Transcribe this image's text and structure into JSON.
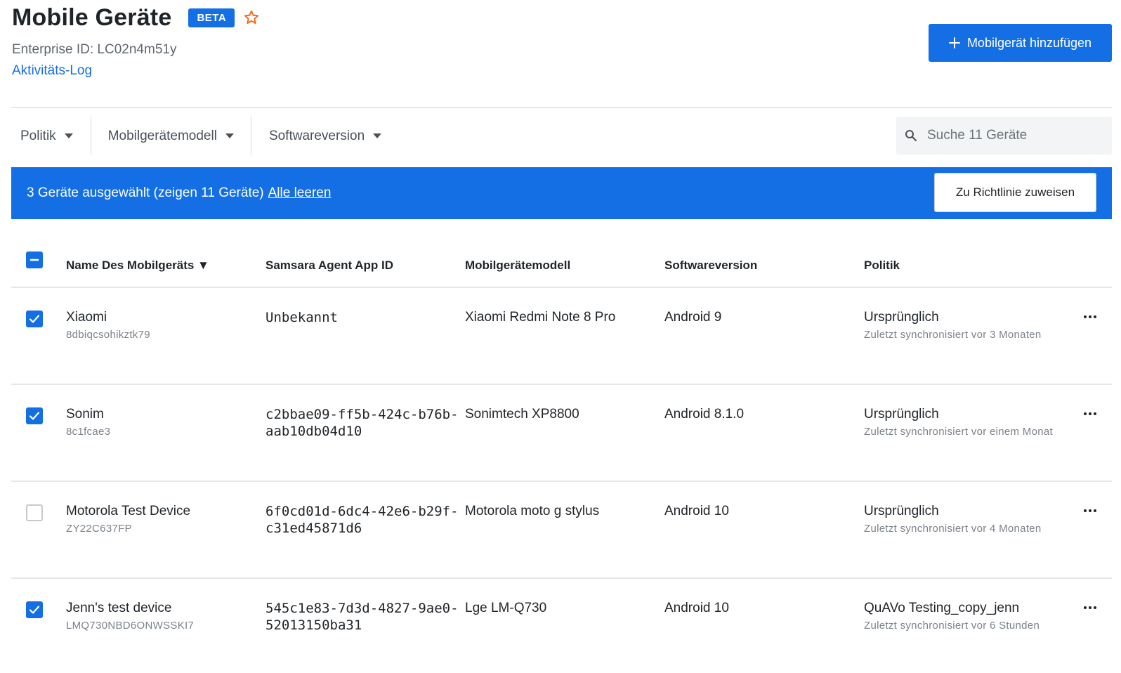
{
  "header": {
    "title": "Mobile Geräte",
    "badge": "BETA",
    "enterprise_id": "Enterprise ID: LC02n4m51y",
    "activity_link": "Aktivitäts-Log",
    "add_button": "Mobilgerät hinzufügen"
  },
  "filters": {
    "policy": "Politik",
    "model": "Mobilgerätemodell",
    "software": "Softwareversion"
  },
  "search": {
    "placeholder": "Suche 11 Geräte"
  },
  "selection": {
    "text": "3 Geräte ausgewählt (zeigen 11 Geräte)",
    "clear": "Alle leeren",
    "assign_button": "Zu Richtlinie zuweisen"
  },
  "table": {
    "headers": {
      "name": "Name Des Mobilgeräts ▼",
      "app_id": "Samsara Agent App ID",
      "model": "Mobilgerätemodell",
      "software": "Softwareversion",
      "policy": "Politik"
    },
    "rows": [
      {
        "checked": true,
        "name": "Xiaomi",
        "serial": "8dbiqcsohikztk79",
        "app_id": "Unbekannt",
        "model": "Xiaomi Redmi Note 8 Pro",
        "software": "Android 9",
        "policy": "Ursprünglich",
        "sync": "Zuletzt synchronisiert vor 3 Monaten"
      },
      {
        "checked": true,
        "name": "Sonim",
        "serial": "8c1fcae3",
        "app_id": "c2bbae09-ff5b-424c-b76b-aab10db04d10",
        "model": "Sonimtech XP8800",
        "software": "Android 8.1.0",
        "policy": "Ursprünglich",
        "sync": "Zuletzt synchronisiert vor einem Monat"
      },
      {
        "checked": false,
        "name": "Motorola Test Device",
        "serial": "ZY22C637FP",
        "app_id": "6f0cd01d-6dc4-42e6-b29f-c31ed45871d6",
        "model": "Motorola moto g stylus",
        "software": "Android 10",
        "policy": "Ursprünglich",
        "sync": "Zuletzt synchronisiert vor 4 Monaten"
      },
      {
        "checked": true,
        "name": "Jenn's test device",
        "serial": "LMQ730NBD6ONWSSKI7",
        "app_id": "545c1e83-7d3d-4827-9ae0-52013150ba31",
        "model": "Lge LM-Q730",
        "software": "Android 10",
        "policy": "QuAVo Testing_copy_jenn",
        "sync": "Zuletzt synchronisiert vor 6 Stunden"
      }
    ]
  },
  "colors": {
    "accent": "#136fe3",
    "star": "#f26b1d",
    "divider": "#e5e7ea"
  },
  "icons": {
    "favorite": "star-outline-icon",
    "add": "plus-icon",
    "search": "search-icon",
    "row_menu": "more-horizontal-icon"
  }
}
